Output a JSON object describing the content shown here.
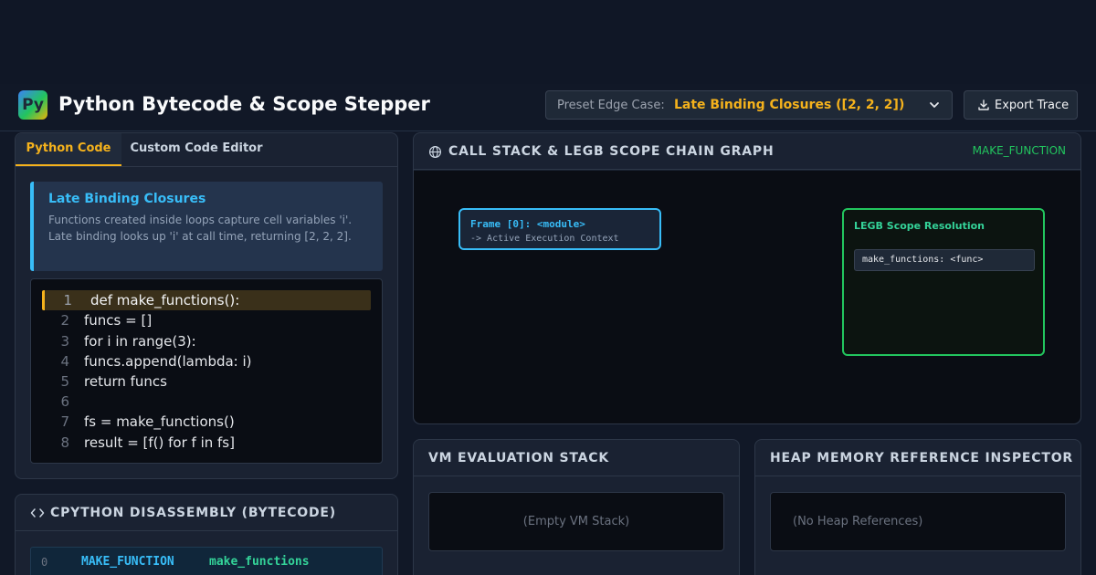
{
  "app": {
    "logo": "Py",
    "title": "Python Bytecode & Scope Stepper"
  },
  "preset": {
    "label": "Preset Edge Case:",
    "value": "Late Binding Closures ([2, 2, 2])"
  },
  "export": {
    "label": "Export Trace"
  },
  "editor": {
    "tabs": [
      {
        "label": "Python Code",
        "active": true
      },
      {
        "label": "Custom Code Editor",
        "active": false
      }
    ],
    "info": {
      "title": "Late Binding Closures",
      "description": "Functions created inside loops capture cell variables 'i'. Late binding looks up 'i' at call time, returning [2, 2, 2]."
    },
    "code_lines": [
      {
        "num": "1",
        "text": "def make_functions():",
        "active": true
      },
      {
        "num": "2",
        "text": "funcs = []",
        "active": false
      },
      {
        "num": "3",
        "text": "for i in range(3):",
        "active": false
      },
      {
        "num": "4",
        "text": "funcs.append(lambda: i)",
        "active": false
      },
      {
        "num": "5",
        "text": "return funcs",
        "active": false
      },
      {
        "num": "6",
        "text": "",
        "active": false
      },
      {
        "num": "7",
        "text": "fs = make_functions()",
        "active": false
      },
      {
        "num": "8",
        "text": "result = [f() for f in fs]",
        "active": false
      }
    ]
  },
  "disassembly": {
    "title": "CPYTHON DISASSEMBLY (BYTECODE)",
    "rows": [
      {
        "offset": "0",
        "opcode": "MAKE_FUNCTION",
        "arg": "make_functions"
      }
    ]
  },
  "graph": {
    "title": "CALL STACK & LEGB SCOPE CHAIN GRAPH",
    "current_opcode": "MAKE_FUNCTION",
    "frame": {
      "label": "Frame [0]: <module>",
      "sublabel": "-> Active Execution Context"
    },
    "legb": {
      "title": "LEGB Scope Resolution",
      "entries": [
        "make_functions: <func>"
      ]
    }
  },
  "vm_stack": {
    "title": "VM EVALUATION STACK",
    "empty_text": "(Empty VM Stack)"
  },
  "heap": {
    "title": "HEAP MEMORY REFERENCE INSPECTOR",
    "empty_text": "(No Heap References)"
  },
  "colors": {
    "accent": "#f5b21c",
    "info": "#38bdf8",
    "success": "#22c55e"
  }
}
